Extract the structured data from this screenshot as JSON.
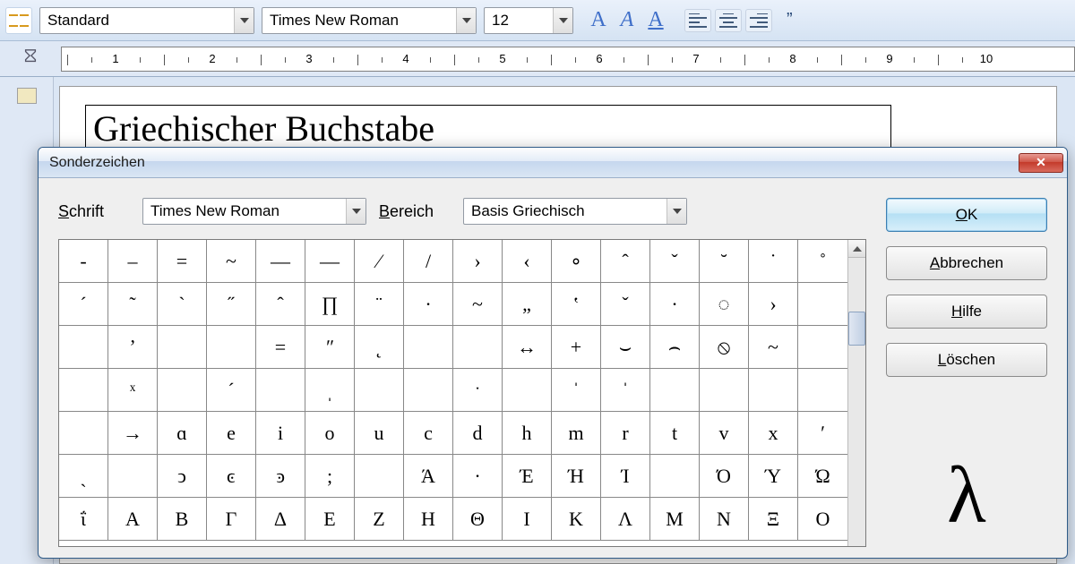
{
  "toolbar": {
    "style_combo": "Standard",
    "font_combo": "Times New Roman",
    "size_combo": "12"
  },
  "ruler": {
    "numbers": [
      1,
      2,
      3,
      4,
      5,
      6,
      7,
      8,
      9,
      10
    ]
  },
  "document": {
    "title_text": "Griechischer Buchstabe"
  },
  "dialog": {
    "title": "Sonderzeichen",
    "font_label_pre": "S",
    "font_label_post": "chrift",
    "font_value": "Times New Roman",
    "range_label_pre": "B",
    "range_label_post": "ereich",
    "range_value": "Basis Griechisch",
    "ok_pre": "O",
    "ok_post": "K",
    "cancel_pre": "A",
    "cancel_post": "bbrechen",
    "help_pre": "H",
    "help_post": "ilfe",
    "delete_pre": "L",
    "delete_post": "öschen",
    "preview_char": "λ",
    "char_rows": [
      [
        "‐",
        "–",
        "=",
        "~",
        "—",
        "―",
        "⁄",
        "/",
        "›",
        "‹",
        "∘",
        "ˆ",
        "ˇ",
        "˘",
        "˙",
        "˚"
      ],
      [
        "´",
        "˜",
        "`",
        "˝",
        "ˆ",
        "∏",
        "¨",
        "·",
        "~",
        "„",
        "‛",
        "ˇ",
        "·",
        "◌",
        "›",
        ""
      ],
      [
        "",
        "ʼ",
        "",
        "",
        "=",
        "ʺ",
        "˛",
        "",
        "",
        "↔",
        "+",
        "⌣",
        "⌢",
        "⦸",
        "~",
        ""
      ],
      [
        "",
        "ˣ",
        "",
        "ˊ",
        "",
        "ˌ",
        "",
        "",
        "ˑ",
        "",
        "ˈ",
        "ˈ",
        "",
        "",
        "",
        ""
      ],
      [
        "",
        "→",
        "ɑ",
        "e",
        "i",
        "o",
        "u",
        "c",
        "d",
        "h",
        "m",
        "r",
        "t",
        "v",
        "x",
        "ʹ"
      ],
      [
        "ˎ",
        "",
        "ͻ",
        "ͼ",
        "ͽ",
        ";",
        "",
        "Ά",
        "·",
        "Έ",
        "Ή",
        "Ί",
        "",
        "Ό",
        "Ύ",
        "Ώ"
      ],
      [
        "ΐ",
        "Α",
        "Β",
        "Γ",
        "Δ",
        "Ε",
        "Ζ",
        "Η",
        "Θ",
        "Ι",
        "Κ",
        "Λ",
        "Μ",
        "Ν",
        "Ξ",
        "Ο"
      ]
    ]
  }
}
